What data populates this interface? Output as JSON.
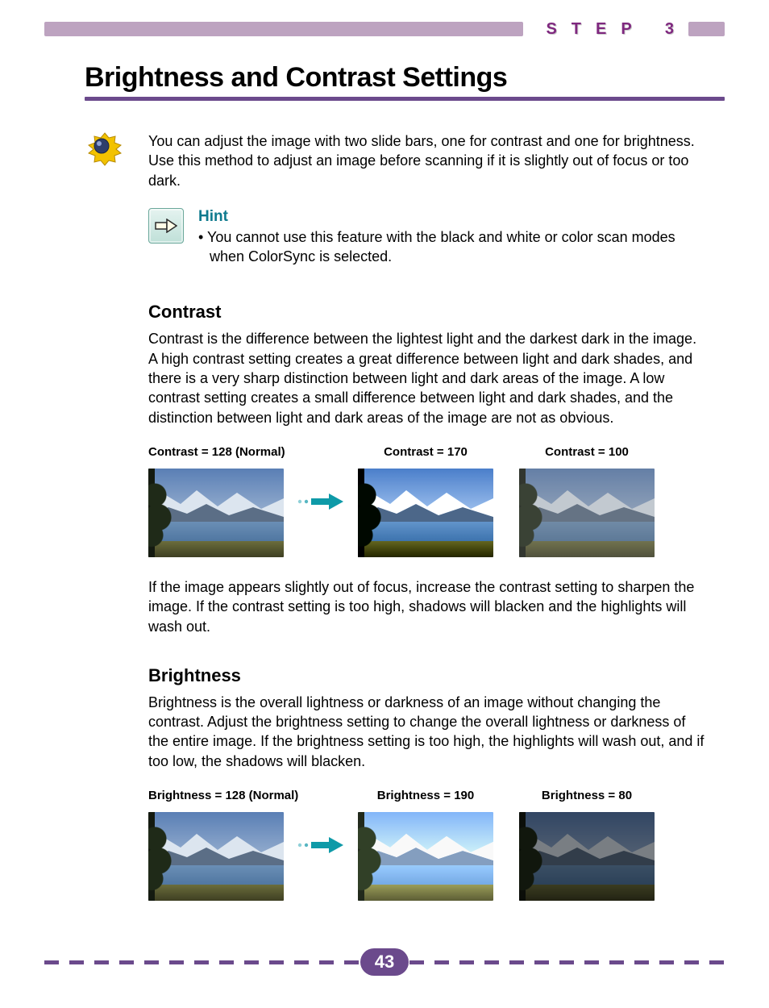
{
  "header": {
    "step_label": "STEP 3"
  },
  "title": "Brightness and Contrast Settings",
  "intro": "You can adjust the image with two slide bars, one for contrast and one for brightness. Use this method to adjust an image before scanning if it is slightly out of focus or too dark.",
  "hint": {
    "label": "Hint",
    "body": "• You cannot use this feature with the black and white or color scan modes when ColorSync is selected."
  },
  "contrast": {
    "heading": "Contrast",
    "body": "Contrast is the difference between the lightest light and the darkest dark in the image. A high contrast setting creates a great difference between light and dark shades, and there is a very sharp distinction between light and dark areas of the image. A low contrast setting creates a small difference between light and dark shades, and the distinction between light and dark areas of the image are not as obvious.",
    "examples": [
      {
        "label": "Contrast = 128 (Normal)",
        "variant": "c-normal"
      },
      {
        "label": "Contrast = 170",
        "variant": "c-high"
      },
      {
        "label": "Contrast = 100",
        "variant": "c-low"
      }
    ],
    "after": "If the image appears slightly out of focus, increase the contrast setting to sharpen the image. If the contrast setting is too high, shadows will blacken and the highlights will wash out."
  },
  "brightness": {
    "heading": "Brightness",
    "body": "Brightness is the overall lightness or darkness of an image without changing the contrast. Adjust the brightness setting to change the overall lightness or darkness of the entire image. If the brightness setting is too high, the highlights will wash out, and if too low, the shadows will blacken.",
    "examples": [
      {
        "label": "Brightness = 128 (Normal)",
        "variant": "b-normal"
      },
      {
        "label": "Brightness = 190",
        "variant": "b-high"
      },
      {
        "label": "Brightness = 80",
        "variant": "b-low"
      }
    ]
  },
  "page_number": "43"
}
